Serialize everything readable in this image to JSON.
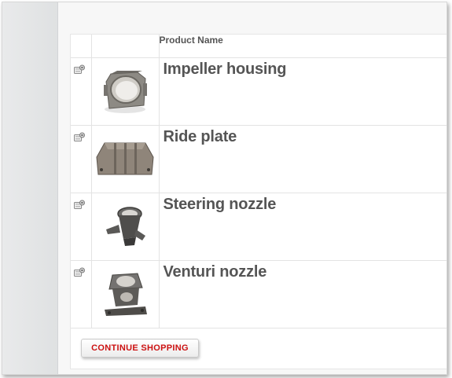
{
  "cart": {
    "header": {
      "product_name": "Product Name"
    },
    "items": [
      {
        "name": "Impeller housing",
        "icon": "remove-icon"
      },
      {
        "name": "Ride plate",
        "icon": "remove-icon"
      },
      {
        "name": "Steering nozzle",
        "icon": "remove-icon"
      },
      {
        "name": "Venturi nozzle",
        "icon": "remove-icon"
      }
    ],
    "continue_label": "CONTINUE SHOPPING"
  },
  "colors": {
    "button_text": "#cc1111",
    "product_text": "#555555",
    "left_rail": "#e3e4e5"
  }
}
